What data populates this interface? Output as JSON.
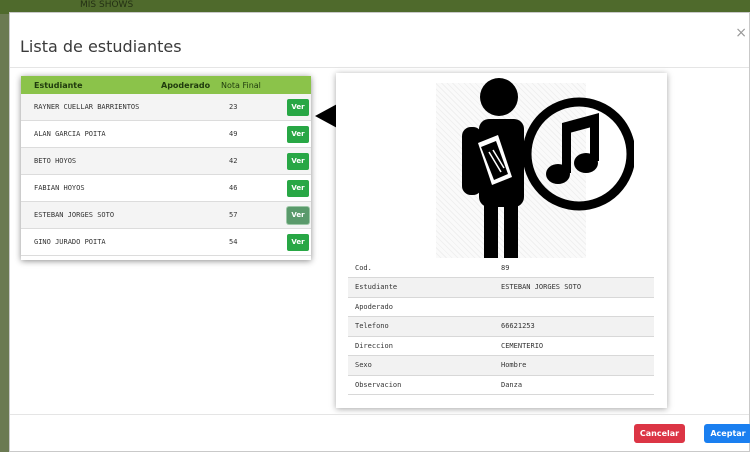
{
  "background": {
    "header_text": "MIS SHOWS"
  },
  "modal": {
    "title": "Lista de estudiantes",
    "close": "×"
  },
  "list": {
    "headers": {
      "name": "Estudiante",
      "apoderado": "Apoderado",
      "nota": "Nota Final"
    },
    "rows": [
      {
        "name": "RAYNER CUELLAR BARRIENTOS",
        "nota": "23",
        "button": "Ver"
      },
      {
        "name": "ALAN GARCIA POITA",
        "nota": "49",
        "button": "Ver"
      },
      {
        "name": "BETO HOYOS",
        "nota": "42",
        "button": "Ver"
      },
      {
        "name": "FABIAN HOYOS",
        "nota": "46",
        "button": "Ver"
      },
      {
        "name": "ESTEBAN JORGES SOTO",
        "nota": "57",
        "button": "Ver"
      },
      {
        "name": "GINO JURADO POITA",
        "nota": "54",
        "button": "Ver"
      }
    ]
  },
  "detail": {
    "icon": "student-music-icon",
    "fields": [
      {
        "label": "Cod.",
        "value": "89"
      },
      {
        "label": "Estudiante",
        "value": "ESTEBAN JORGES SOTO"
      },
      {
        "label": "Apoderado",
        "value": ""
      },
      {
        "label": "Telefono",
        "value": "66621253"
      },
      {
        "label": "Direccion",
        "value": "CEMENTERIO"
      },
      {
        "label": "Sexo",
        "value": "Hombre"
      },
      {
        "label": "Observacion",
        "value": "Danza"
      }
    ]
  },
  "footer": {
    "cancel": "Cancelar",
    "accept": "Aceptar"
  },
  "colors": {
    "list_header": "#8bc34a",
    "ver": "#28a745",
    "cancel": "#dc3545",
    "accept": "#1a7ff0"
  }
}
